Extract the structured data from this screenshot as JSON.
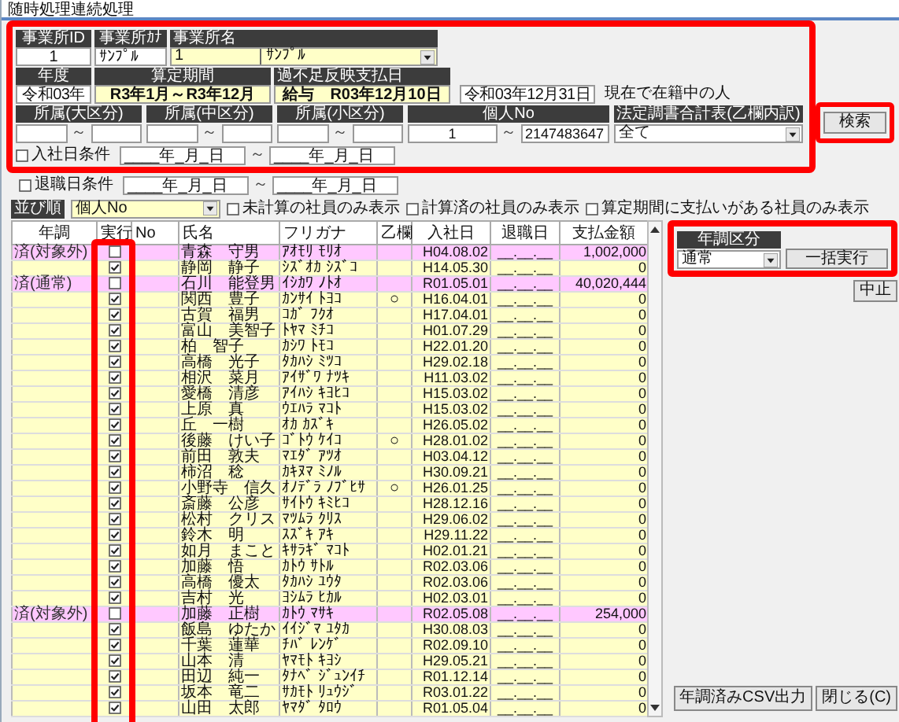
{
  "window": {
    "title": "随時処理連続処理"
  },
  "filters": {
    "highlighted": true,
    "office": {
      "labels": [
        "事業所ID",
        "事業所ｶﾅ",
        "事業所名"
      ],
      "id": "1",
      "kana": "ｻﾝﾌﾟﾙ",
      "code": "1",
      "name": "ｻﾝﾌﾟﾙ"
    },
    "period": {
      "labels": [
        "年度",
        "算定期間",
        "過不足反映支払日"
      ],
      "year": "令和03年",
      "range": "R3年1月～R3年12月",
      "payday": "給与　R03年12月10日",
      "as_of": "令和03年12月31日",
      "as_of_note": "現在で在籍中の人"
    },
    "ranges": [
      {
        "label": "所属(大区分)",
        "separator": "～"
      },
      {
        "label": "所属(中区分)",
        "separator": "～"
      },
      {
        "label": "所属(小区分)",
        "separator": "～"
      },
      {
        "label": "個人No",
        "from": "1",
        "separator": "～",
        "to": "2147483647"
      }
    ],
    "statutory": {
      "label": "法定調書合計表(乙欄内訳)",
      "value": "全て"
    },
    "hire_date": {
      "label": "入社日条件",
      "checked": false,
      "from": "____年_月_日",
      "separator": "～",
      "to": "____年_月_日"
    }
  },
  "search_button": {
    "label": "検索",
    "highlighted": true
  },
  "retire_date": {
    "label": "退職日条件",
    "checked": false,
    "from": "____年_月_日",
    "separator": "～",
    "to": "____年_月_日"
  },
  "sort": {
    "label": "並び順",
    "value": "個人No"
  },
  "display_options": [
    {
      "label": "未計算の社員のみ表示",
      "checked": false
    },
    {
      "label": "計算済の社員のみ表示",
      "checked": false
    },
    {
      "label": "算定期間に支払いがある社員のみ表示",
      "checked": false
    }
  ],
  "table": {
    "execute_highlighted": true,
    "columns": [
      "年調",
      "実行",
      "No",
      "氏名",
      "フリガナ",
      "乙欄",
      "入社日",
      "退職日",
      "支払金額"
    ],
    "rows": [
      {
        "status": "済(対象外)",
        "done": true,
        "execute": false,
        "name": "青森　守男",
        "kana": "ｱｵﾓﾘ ﾓﾘｵ",
        "hire_date": "H04.08.02",
        "retire_date": "__.__.__",
        "payment": "1,002,000"
      },
      {
        "done": false,
        "execute": true,
        "name": "静岡　静子",
        "kana": "ｼｽﾞｵｶ ｼｽﾞｺ",
        "hire_date": "H14.05.30",
        "retire_date": "__.__.__",
        "payment": "0"
      },
      {
        "status": "済(通常)",
        "done": true,
        "execute": false,
        "name": "石川　能登男",
        "kana": "ｲｼｶﾜ ﾉﾄｵ",
        "hire_date": "R01.05.01",
        "retire_date": "__.__.__",
        "payment": "40,020,444"
      },
      {
        "done": false,
        "execute": true,
        "name": "関西　豊子",
        "kana": "ｶﾝｻｲ ﾄﾖｺ",
        "otsu": "○",
        "hire_date": "H16.04.01",
        "retire_date": "__.__.__",
        "payment": "0"
      },
      {
        "done": false,
        "execute": true,
        "name": "古賀　福男",
        "kana": "ｺｶﾞ ﾌｸｵ",
        "hire_date": "H17.04.01",
        "retire_date": "__.__.__",
        "payment": "0"
      },
      {
        "done": false,
        "execute": true,
        "name": "富山　美智子",
        "kana": "ﾄﾔﾏ ﾐﾁｺ",
        "hire_date": "H01.07.29",
        "retire_date": "__.__.__",
        "payment": "0"
      },
      {
        "done": false,
        "execute": true,
        "name": "柏　智子",
        "kana": "ｶｼﾜ ﾄﾓｺ",
        "hire_date": "H22.01.20",
        "retire_date": "__.__.__",
        "payment": "0"
      },
      {
        "done": false,
        "execute": true,
        "name": "高橋　光子",
        "kana": "ﾀｶﾊｼ ﾐﾂｺ",
        "hire_date": "H29.02.18",
        "retire_date": "__.__.__",
        "payment": "0"
      },
      {
        "done": false,
        "execute": true,
        "name": "相沢　菜月",
        "kana": "ｱｲｻﾞﾜ ﾅﾂｷ",
        "hire_date": "H11.03.02",
        "retire_date": "__.__.__",
        "payment": "0"
      },
      {
        "done": false,
        "execute": true,
        "name": "愛橋　清彦",
        "kana": "ｱｲﾊｼ ｷﾖﾋｺ",
        "hire_date": "H15.03.02",
        "retire_date": "__.__.__",
        "payment": "0"
      },
      {
        "done": false,
        "execute": true,
        "name": "上原　真",
        "kana": "ｳｴﾊﾗ ﾏｺﾄ",
        "hire_date": "H15.03.02",
        "retire_date": "__.__.__",
        "payment": "0"
      },
      {
        "done": false,
        "execute": true,
        "name": "丘　一樹",
        "kana": "ｵｶ ｶｽﾞｷ",
        "hire_date": "H26.05.02",
        "retire_date": "__.__.__",
        "payment": "0"
      },
      {
        "done": false,
        "execute": true,
        "name": "後藤　けい子",
        "kana": "ｺﾞﾄｳ ｹｲｺ",
        "otsu": "○",
        "hire_date": "H28.01.02",
        "retire_date": "__.__.__",
        "payment": "0"
      },
      {
        "done": false,
        "execute": true,
        "name": "前田　敦夫",
        "kana": "ﾏｴﾀﾞ ｱﾂｵ",
        "hire_date": "H03.04.12",
        "retire_date": "__.__.__",
        "payment": "0"
      },
      {
        "done": false,
        "execute": true,
        "name": "柿沼　稔",
        "kana": "ｶｷﾇﾏ ﾐﾉﾙ",
        "hire_date": "H30.09.21",
        "retire_date": "__.__.__",
        "payment": "0"
      },
      {
        "done": false,
        "execute": true,
        "name": "小野寺　信久",
        "kana": "ｵﾉﾃﾞﾗ ﾉﾌﾞﾋｻ",
        "otsu": "○",
        "hire_date": "H26.01.25",
        "retire_date": "__.__.__",
        "payment": "0"
      },
      {
        "done": false,
        "execute": true,
        "name": "斎藤　公彦",
        "kana": "ｻｲﾄｳ ｷﾐﾋｺ",
        "hire_date": "H28.12.16",
        "retire_date": "__.__.__",
        "payment": "0"
      },
      {
        "done": false,
        "execute": true,
        "name": "松村　クリス",
        "kana": "ﾏﾂﾑﾗ ｸﾘｽ",
        "hire_date": "H29.06.02",
        "retire_date": "__.__.__",
        "payment": "0"
      },
      {
        "done": false,
        "execute": true,
        "name": "鈴木　明",
        "kana": "ｽｽﾞｷ ｱｷ",
        "hire_date": "H29.11.22",
        "retire_date": "__.__.__",
        "payment": "0"
      },
      {
        "done": false,
        "execute": true,
        "name": "如月　まこと",
        "kana": "ｷｻﾗｷﾞ ﾏｺﾄ",
        "hire_date": "H02.01.21",
        "retire_date": "__.__.__",
        "payment": "0"
      },
      {
        "done": false,
        "execute": true,
        "name": "加藤　悟",
        "kana": "ｶﾄｳ ｻﾄﾙ",
        "hire_date": "R02.03.06",
        "retire_date": "__.__.__",
        "payment": "0"
      },
      {
        "done": false,
        "execute": true,
        "name": "高橋　優太",
        "kana": "ﾀｶﾊｼ ﾕｳﾀ",
        "hire_date": "R02.03.06",
        "retire_date": "__.__.__",
        "payment": "0"
      },
      {
        "done": false,
        "execute": true,
        "name": "吉村　光",
        "kana": "ﾖｼﾑﾗ ﾋｶﾙ",
        "hire_date": "H02.03.01",
        "retire_date": "__.__.__",
        "payment": "0"
      },
      {
        "status": "済(対象外)",
        "done": true,
        "execute": false,
        "name": "加藤　正樹",
        "kana": "ｶﾄｳ ﾏｻｷ",
        "hire_date": "R02.05.08",
        "retire_date": "__.__.__",
        "payment": "254,000"
      },
      {
        "done": false,
        "execute": true,
        "name": "飯島　ゆたか",
        "kana": "ｲｲｼﾞﾏ ﾕﾀｶ",
        "hire_date": "H30.08.03",
        "retire_date": "__.__.__",
        "payment": "0"
      },
      {
        "done": false,
        "execute": true,
        "name": "千葉　蓮華",
        "kana": "ﾁﾊﾞ ﾚﾝｹﾞ",
        "hire_date": "R02.09.10",
        "retire_date": "__.__.__",
        "payment": "0"
      },
      {
        "done": false,
        "execute": true,
        "name": "山本　清",
        "kana": "ﾔﾏﾓﾄ ｷﾖｼ",
        "hire_date": "H29.05.21",
        "retire_date": "__.__.__",
        "payment": "0"
      },
      {
        "done": false,
        "execute": true,
        "name": "田辺　純一",
        "kana": "ﾀﾅﾍﾞ ｼﾞｭﾝｲﾁ",
        "hire_date": "R01.12.14",
        "retire_date": "__.__.__",
        "payment": "0"
      },
      {
        "done": false,
        "execute": true,
        "name": "坂本　竜二",
        "kana": "ｻｶﾓﾄ ﾘｭｳｼﾞ",
        "hire_date": "R03.01.22",
        "retire_date": "__.__.__",
        "payment": "0"
      },
      {
        "done": false,
        "execute": true,
        "name": "山田　太郎",
        "kana": "ﾔﾏﾀﾞ ﾀﾛｳ",
        "hire_date": "R01.05.04",
        "retire_date": "__.__.__",
        "payment": "0"
      }
    ]
  },
  "adjust_panel": {
    "highlighted": true,
    "label": "年調区分",
    "value": "通常",
    "button": "一括実行"
  },
  "stop_button": "中止",
  "footer_buttons": [
    "年調済みCSV出力",
    "閉じる(C)"
  ]
}
